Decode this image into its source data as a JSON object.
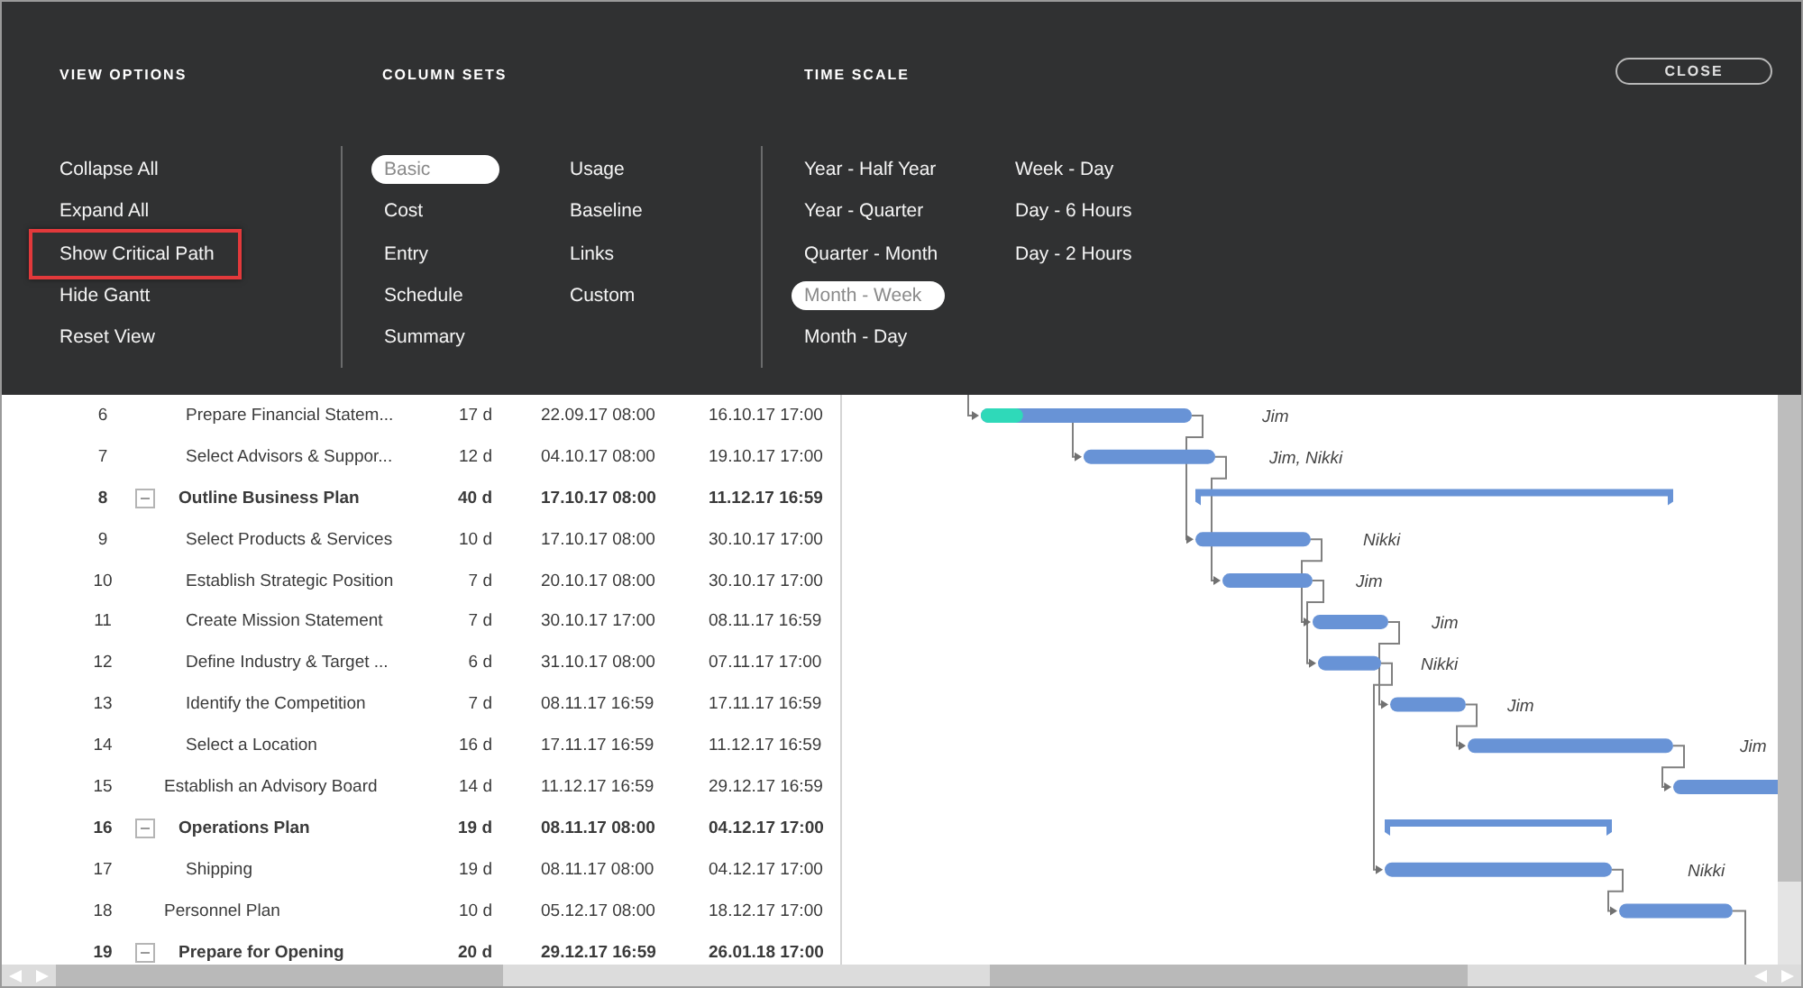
{
  "view_options": {
    "heading": "VIEW OPTIONS",
    "items": [
      {
        "label": "Collapse All",
        "highlighted": false
      },
      {
        "label": "Expand All",
        "highlighted": false
      },
      {
        "label": "Show Critical Path",
        "highlighted": true
      },
      {
        "label": "Hide Gantt",
        "highlighted": false
      },
      {
        "label": "Reset View",
        "highlighted": false
      }
    ]
  },
  "column_sets": {
    "heading": "COLUMN SETS",
    "columns": [
      {
        "items": [
          {
            "label": "Basic",
            "selected": true
          },
          {
            "label": "Cost",
            "selected": false
          },
          {
            "label": "Entry",
            "selected": false
          },
          {
            "label": "Schedule",
            "selected": false
          },
          {
            "label": "Summary",
            "selected": false
          }
        ]
      },
      {
        "items": [
          {
            "label": "Usage",
            "selected": false
          },
          {
            "label": "Baseline",
            "selected": false
          },
          {
            "label": "Links",
            "selected": false
          },
          {
            "label": "Custom",
            "selected": false
          }
        ]
      }
    ]
  },
  "time_scale": {
    "heading": "TIME SCALE",
    "columns": [
      {
        "items": [
          {
            "label": "Year - Half Year",
            "selected": false
          },
          {
            "label": "Year - Quarter",
            "selected": false
          },
          {
            "label": "Quarter - Month",
            "selected": false
          },
          {
            "label": "Month - Week",
            "selected": true
          },
          {
            "label": "Month - Day",
            "selected": false
          }
        ]
      },
      {
        "items": [
          {
            "label": "Week - Day",
            "selected": false
          },
          {
            "label": "Day - 6 Hours",
            "selected": false
          },
          {
            "label": "Day - 2 Hours",
            "selected": false
          }
        ]
      }
    ]
  },
  "close_button": "CLOSE",
  "tasks": [
    {
      "kind": "group",
      "children": [
        {
          "kind": "task",
          "number": "6",
          "name": "Prepare Financial Statem...",
          "duration": "17 d",
          "start": "22.09.17 08:00",
          "finish": "16.10.17 17:00",
          "resources": "Jim",
          "level": 0.2
        },
        {
          "kind": "task",
          "number": "7",
          "name": "Select Advisors & Suppor...",
          "duration": "12 d",
          "start": "04.10.17 08:00",
          "finish": "19.10.17 17:00",
          "resources": "Jim, Nikki"
        }
      ]
    },
    {
      "kind": "summary",
      "expanded": true,
      "number": "8",
      "name": "Outline Business Plan",
      "duration": "40 d",
      "start": "17.10.17 08:00",
      "finish": "11.12.17 16:59",
      "children": [
        {
          "kind": "task",
          "number": "9",
          "name": "Select Products & Services",
          "duration": "10 d",
          "start": "17.10.17 08:00",
          "finish": "30.10.17 17:00",
          "resources": "Nikki"
        },
        {
          "kind": "task",
          "number": "10",
          "name": "Establish Strategic Position",
          "duration": "7 d",
          "start": "20.10.17 08:00",
          "finish": "30.10.17 17:00",
          "resources": "Jim"
        },
        {
          "kind": "task",
          "number": "11",
          "name": "Create Mission Statement",
          "duration": "7 d",
          "start": "30.10.17 17:00",
          "finish": "08.11.17 16:59",
          "resources": "Jim"
        },
        {
          "kind": "task",
          "number": "12",
          "name": "Define Industry & Target ...",
          "duration": "6 d",
          "start": "31.10.17 08:00",
          "finish": "07.11.17 17:00",
          "resources": "Nikki"
        },
        {
          "kind": "task",
          "number": "13",
          "name": "Identify the Competition",
          "duration": "7 d",
          "start": "08.11.17 16:59",
          "finish": "17.11.17 16:59",
          "resources": "Jim"
        },
        {
          "kind": "task",
          "number": "14",
          "name": "Select a Location",
          "duration": "16 d",
          "start": "17.11.17 16:59",
          "finish": "11.12.17 16:59",
          "resources": "Jim"
        }
      ]
    },
    {
      "kind": "task",
      "number": "15",
      "name": "Establish an Advisory Board",
      "duration": "14 d",
      "start": "11.12.17 16:59",
      "finish": "29.12.17 16:59"
    },
    {
      "kind": "summary",
      "expanded": true,
      "number": "16",
      "name": "Operations Plan",
      "duration": "19 d",
      "start": "08.11.17 08:00",
      "finish": "04.12.17 17:00",
      "children": [
        {
          "kind": "task",
          "number": "17",
          "name": "Shipping",
          "duration": "19 d",
          "start": "08.11.17 08:00",
          "finish": "04.12.17 17:00",
          "resources": "Nikki"
        }
      ]
    },
    {
      "kind": "task",
      "number": "18",
      "name": "Personnel Plan",
      "duration": "10 d",
      "start": "05.12.17 08:00",
      "finish": "18.12.17 17:00"
    },
    {
      "kind": "summary",
      "expanded": true,
      "number": "19",
      "name": "Prepare for Opening",
      "duration": "20 d",
      "start": "29.12.17 16:59",
      "finish": "26.01.18 17:00"
    }
  ]
}
